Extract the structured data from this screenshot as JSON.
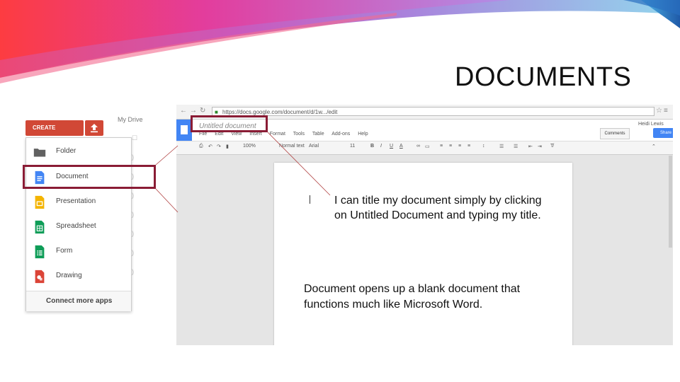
{
  "slide": {
    "title": "DOCUMENTS",
    "accent_color": "#8a1c35"
  },
  "drive": {
    "create_label": "CREATE",
    "my_drive_label": "My Drive",
    "menu_items": [
      {
        "label": "Folder",
        "icon": "folder-icon",
        "color": "#616161"
      },
      {
        "label": "Document",
        "icon": "document-icon",
        "color": "#4285f4"
      },
      {
        "label": "Presentation",
        "icon": "presentation-icon",
        "color": "#f4b400"
      },
      {
        "label": "Spreadsheet",
        "icon": "spreadsheet-icon",
        "color": "#0f9d58"
      },
      {
        "label": "Form",
        "icon": "form-icon",
        "color": "#0f9d58"
      },
      {
        "label": "Drawing",
        "icon": "drawing-icon",
        "color": "#db4437"
      }
    ],
    "connect_more": "Connect more apps"
  },
  "docs": {
    "url": "https://docs.google.com/document/d/1w.../edit",
    "doc_title": "Untitled document",
    "menu": [
      "File",
      "Edit",
      "View",
      "Insert",
      "Format",
      "Tools",
      "Table",
      "Add-ons",
      "Help"
    ],
    "user_name": "Heidi Lewis",
    "comments_label": "Comments",
    "share_label": "Share",
    "toolbar": {
      "zoom": "100%",
      "style": "Normal text",
      "font": "Arial",
      "size": "11"
    }
  },
  "callouts": {
    "title_tip": "I can title my document simply by clicking on Untitled Document and typing my title.",
    "blank_tip": "Document opens up a blank document that functions much like Microsoft Word."
  }
}
